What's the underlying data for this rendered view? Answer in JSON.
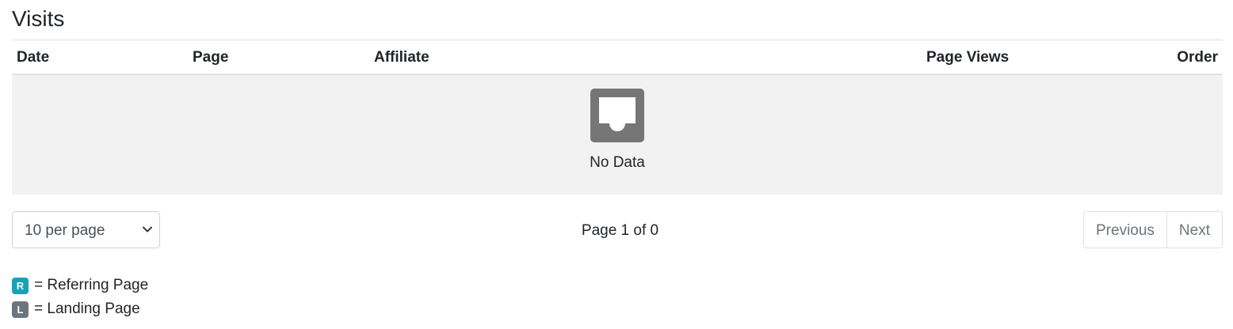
{
  "section": {
    "title": "Visits"
  },
  "table": {
    "columns": [
      "Date",
      "Page",
      "Affiliate",
      "Page Views",
      "Order"
    ],
    "empty_icon": "inbox-icon",
    "empty_text": "No Data"
  },
  "pagination": {
    "per_page_label": "10 per page",
    "page_info": "Page 1 of 0",
    "previous_label": "Previous",
    "next_label": "Next"
  },
  "legend": [
    {
      "badge": "R",
      "text": "= Referring Page",
      "color": "#17a2b8"
    },
    {
      "badge": "L",
      "text": "= Landing Page",
      "color": "#6c757d"
    }
  ],
  "colors": {
    "empty_bg": "#f2f2f2",
    "icon_gray": "#767676",
    "referring_badge": "#17a2b8",
    "landing_badge": "#6c757d"
  }
}
